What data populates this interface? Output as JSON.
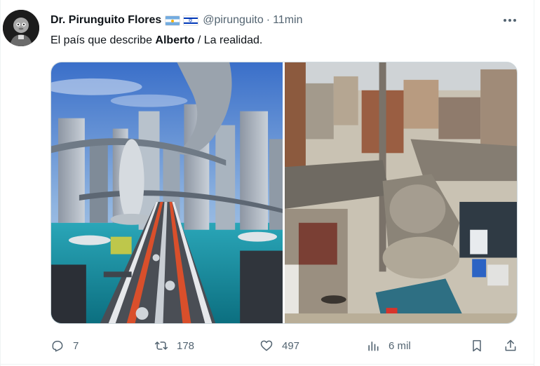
{
  "author": {
    "display_name": "Dr. Pirunguito Flores",
    "handle": "@pirunguito",
    "separator": "·",
    "time": "11min",
    "flags": [
      "argentina-flag",
      "israel-flag"
    ]
  },
  "tweet": {
    "text_before": "El país que describe ",
    "text_bold": "Alberto",
    "text_after": " / La realidad."
  },
  "media": {
    "images": [
      "futuristic-city-image",
      "slum-image"
    ]
  },
  "actions": {
    "replies": "7",
    "retweets": "178",
    "likes": "497",
    "views": "6 mil"
  },
  "colors": {
    "text_primary": "#0f1419",
    "text_secondary": "#536471",
    "border": "#cfd9de"
  }
}
